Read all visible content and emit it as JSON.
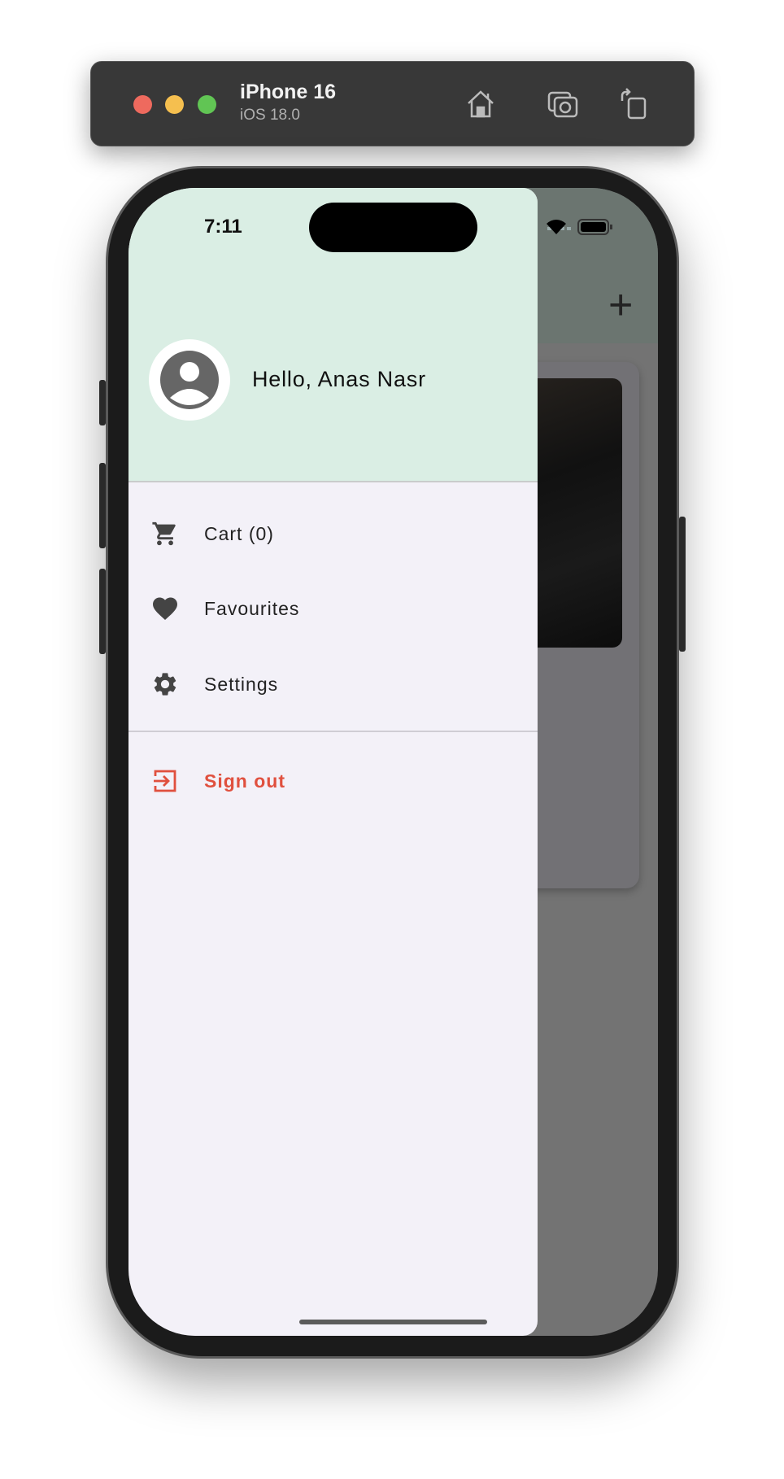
{
  "simulator": {
    "device": "iPhone 16",
    "os": "iOS 18.0",
    "icons": [
      "home-icon",
      "screenshot-icon",
      "rotate-icon"
    ]
  },
  "status_bar": {
    "time": "7:11"
  },
  "drawer": {
    "greeting": "Hello, Anas Nasr",
    "items": [
      {
        "label": "Cart (0)",
        "icon": "cart-icon"
      },
      {
        "label": "Favourites",
        "icon": "heart-icon"
      },
      {
        "label": "Settings",
        "icon": "gear-icon"
      }
    ],
    "sign_out": {
      "label": "Sign out",
      "icon": "logout-icon",
      "color": "#e0503e"
    }
  },
  "background_app": {
    "add_icon": "+",
    "more_icon": "•••"
  }
}
